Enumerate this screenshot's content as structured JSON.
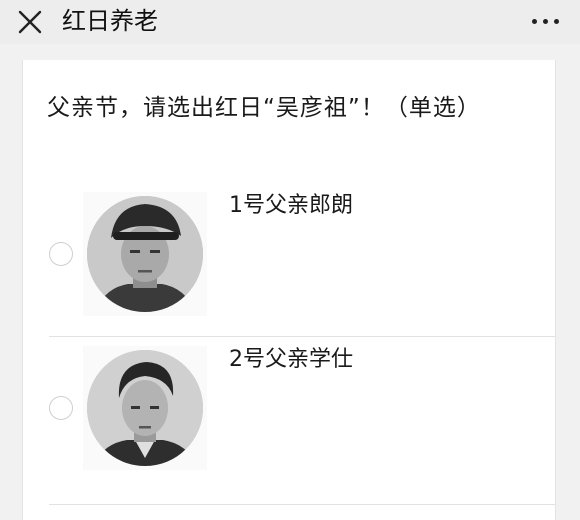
{
  "header": {
    "title": "红日养老",
    "close_icon": "close-icon",
    "more_icon": "more-dots-icon"
  },
  "question": {
    "text": "父亲节，请选出红日“吴彦祖”！（单选）"
  },
  "options": [
    {
      "label": "1号父亲郎朗",
      "selected": false
    },
    {
      "label": "2号父亲学仕",
      "selected": false
    }
  ],
  "colors": {
    "header_bg": "#ededed",
    "page_bg": "#f1f1f1",
    "card_bg": "#ffffff",
    "radio_border": "#cfcfcf"
  }
}
